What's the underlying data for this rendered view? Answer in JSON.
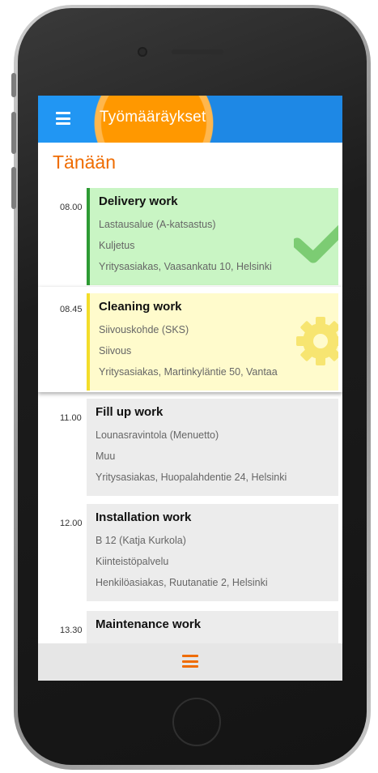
{
  "app": {
    "title": "Työmääräykset",
    "section_title": "Tänään",
    "accent_color": "#ff9800",
    "appbar_color": "#2196f3"
  },
  "work_orders": [
    {
      "time": "08.00",
      "title": "Delivery work",
      "location": "Lastausalue (A-katsastus)",
      "category": "Kuljetus",
      "customer": "Yritysasiakas, Vaasankatu 10, Helsinki",
      "status_icon": "check-icon",
      "status_color": "#2e9b34"
    },
    {
      "time": "08.45",
      "title": "Cleaning work",
      "location": "Siivouskohde (SKS)",
      "category": "Siivous",
      "customer": "Yritysasiakas, Martinkyläntie 50, Vantaa",
      "status_icon": "gear-icon",
      "status_color": "#f3dd2a"
    },
    {
      "time": "11.00",
      "title": "Fill up work",
      "location": "Lounasravintola (Menuetto)",
      "category": "Muu",
      "customer": "Yritysasiakas, Huopalahdentie 24, Helsinki"
    },
    {
      "time": "12.00",
      "title": "Installation work",
      "location": "B 12 (Katja Kurkola)",
      "category": "Kiinteistöpalvelu",
      "customer": "Henkilöasiakas, Ruutanatie 2, Helsinki"
    },
    {
      "time": "13.30",
      "title": "Maintenance work"
    }
  ]
}
